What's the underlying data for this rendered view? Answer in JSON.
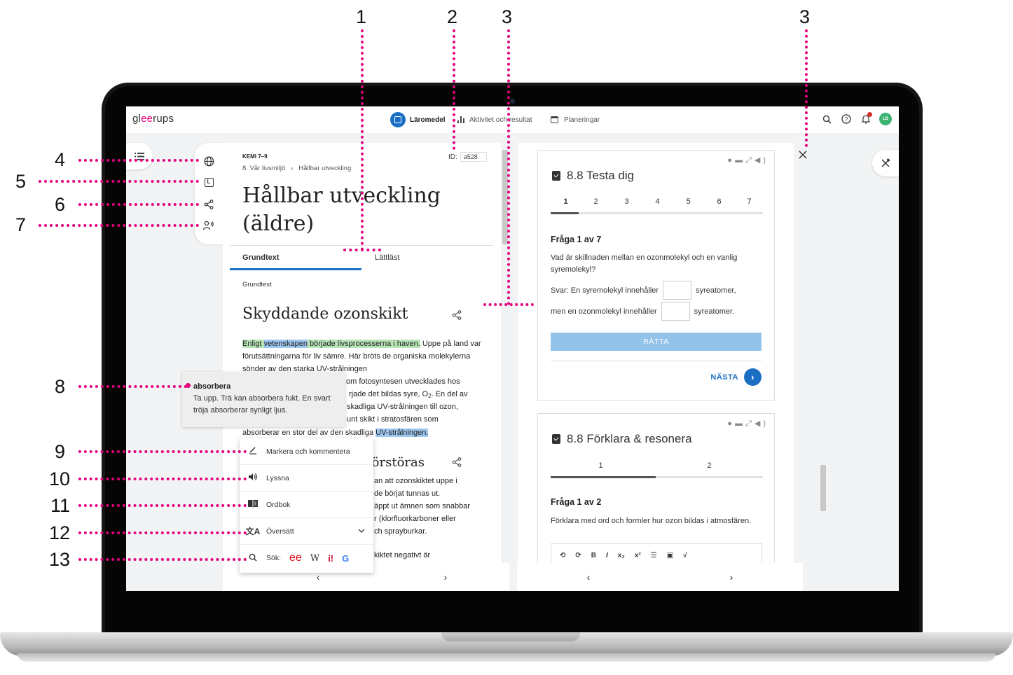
{
  "app": {
    "logo_pre": "gl",
    "logo_ee": "ee",
    "logo_post": "rups"
  },
  "topnav": {
    "laromedel": "Läromedel",
    "aktivitet": "Aktivitet och resultat",
    "planeringar": "Planeringar",
    "avatar": "LB"
  },
  "icons": {
    "menu": "list-icon",
    "globe": "globe-icon",
    "reading": "easy-read-icon",
    "share": "share-icon",
    "speaker": "listen-icon",
    "search": "search-icon",
    "help": "help-icon",
    "bell": "bell-icon",
    "tools": "tools-icon"
  },
  "article": {
    "course": "KEMI 7–9",
    "breadcrumb_1": "8. Vår livsmiljö",
    "breadcrumb_sep": "›",
    "breadcrumb_2": "Hållbar utveckling",
    "id_label": "ID:",
    "id_value": "a528",
    "title": "Hållbar utveckling (äldre)",
    "tab_1": "Grundtext",
    "tab_2": "Lättläst",
    "section_label": "Grundtext",
    "heading_1": "Skyddande ozonskikt",
    "p1_hl_green_a": "Enligt ",
    "p1_hl_blue": "vetenskapen",
    "p1_hl_green_b": " började livsprocesserna i haven.",
    "p1_rest": " Uppe på land var förutsättningarna för liv sämre. Här bröts de organiska molekylerna sönder av den starka UV-strålningen",
    "p1_l5": "om fotosyntesen utvecklades hos",
    "p1_l6a": "rjade det bildas syre, O",
    "p1_l6_sub": "2",
    "p1_l6b": ". En del av",
    "p1_l7": "skadliga UV-strålningen till ozon,",
    "p1_l8": "unt skikt i stratosfären som",
    "p1_l9a": "absorberar en stor del av den skadliga ",
    "p1_l9_hl": "UV-strålningen.",
    "heading_2": "förstöras",
    "p2_l1": "an att ozonskiktet uppe i",
    "p2_l2": "de börjat tunnas ut.",
    "p2_l3": "äppt ut ämnen som snabbar",
    "p2_l4": "r (klorfluorkarboner eller",
    "p2_l5": "ch sprayburkar.",
    "p2_l6": "kiktet negativt är"
  },
  "dictionary": {
    "word": "absorbera",
    "definition": "Ta upp. Trä kan absorbera fukt. En svart tröja absorberar synligt ljus."
  },
  "context_menu": {
    "mark": "Markera och kommentera",
    "listen": "Lyssna",
    "dictionary": "Ordbok",
    "translate": "Översätt",
    "search": "Sök:",
    "sources": [
      "ee",
      "W",
      "i!",
      "G"
    ]
  },
  "quiz_1": {
    "title": "8.8 Testa dig",
    "tabs": [
      "1",
      "2",
      "3",
      "4",
      "5",
      "6",
      "7"
    ],
    "question_heading": "Fråga 1 av 7",
    "question": "Vad är skillnaden mellan en ozonmolekyl och en vanlig syremolekyl?",
    "answer_a": "Svar: En syremolekyl innehåller",
    "answer_b": "syreatomer,",
    "answer_c": "men en ozonmolekyl innehåller",
    "answer_d": "syreatomer.",
    "check_button": "RÄTTA",
    "next_button": "NÄSTA"
  },
  "quiz_2": {
    "title": "8.8 Förklara & resonera",
    "tabs": [
      "1",
      "2"
    ],
    "question_heading": "Fråga 1 av 2",
    "question": "Förklara med ord och formler hur ozon bildas i atmosfären.",
    "toolbar": [
      "⟲",
      "⟳",
      "B",
      "I",
      "x₂",
      "x²",
      "☰",
      "▣",
      "√"
    ]
  },
  "pager": {
    "prev": "‹",
    "next": "›"
  },
  "callouts": [
    "1",
    "2",
    "3",
    "3",
    "4",
    "5",
    "6",
    "7",
    "8",
    "9",
    "10",
    "11",
    "12",
    "13"
  ],
  "colors": {
    "accent": "#1a6fc2",
    "brand": "#e6007e",
    "highlight_green": "#b7e4b5",
    "highlight_blue": "#9ec6ee",
    "check_button": "#94c3ea"
  }
}
